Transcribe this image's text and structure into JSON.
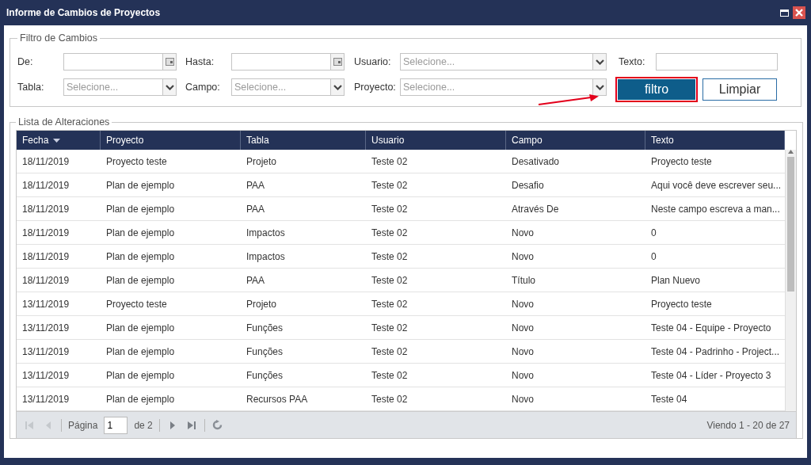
{
  "window": {
    "title": "Informe de Cambios de Proyectos"
  },
  "filter": {
    "legend": "Filtro de Cambios",
    "rows": [
      [
        {
          "label": "De:",
          "kind": "date"
        },
        {
          "label": "Hasta:",
          "kind": "date"
        },
        {
          "label": "Usuario:",
          "kind": "select",
          "placeholder": "Selecione..."
        },
        {
          "label": "Texto:",
          "kind": "text"
        }
      ],
      [
        {
          "label": "Tabla:",
          "kind": "select",
          "placeholder": "Selecione..."
        },
        {
          "label": "Campo:",
          "kind": "select",
          "placeholder": "Selecione..."
        },
        {
          "label": "Proyecto:",
          "kind": "select",
          "placeholder": "Selecione..."
        }
      ]
    ],
    "buttons": [
      {
        "label": "filtro",
        "kind": "primary",
        "highlighted": true
      },
      {
        "label": "Limpiar",
        "kind": "secondary",
        "highlighted": false
      }
    ]
  },
  "list": {
    "legend": "Lista de Alteraciones",
    "columns": [
      {
        "label": "Fecha",
        "sorted": true
      },
      {
        "label": "Proyecto",
        "sorted": false
      },
      {
        "label": "Tabla",
        "sorted": false
      },
      {
        "label": "Usuario",
        "sorted": false
      },
      {
        "label": "Campo",
        "sorted": false
      },
      {
        "label": "Texto",
        "sorted": false
      }
    ],
    "rows": [
      [
        "18/11/2019",
        "Proyecto teste",
        "Projeto",
        "Teste 02",
        "Desativado",
        "Proyecto teste"
      ],
      [
        "18/11/2019",
        "Plan de ejemplo",
        "PAA",
        "Teste 02",
        "Desafio",
        "Aqui você deve escrever seu..."
      ],
      [
        "18/11/2019",
        "Plan de ejemplo",
        "PAA",
        "Teste 02",
        "Através De",
        "Neste campo escreva a man..."
      ],
      [
        "18/11/2019",
        "Plan de ejemplo",
        "Impactos",
        "Teste 02",
        "Novo",
        "0"
      ],
      [
        "18/11/2019",
        "Plan de ejemplo",
        "Impactos",
        "Teste 02",
        "Novo",
        "0"
      ],
      [
        "18/11/2019",
        "Plan de ejemplo",
        "PAA",
        "Teste 02",
        "Título",
        "Plan Nuevo"
      ],
      [
        "13/11/2019",
        "Proyecto teste",
        "Projeto",
        "Teste 02",
        "Novo",
        "Proyecto teste"
      ],
      [
        "13/11/2019",
        "Plan de ejemplo",
        "Funções",
        "Teste 02",
        "Novo",
        "Teste 04 - Equipe - Proyecto"
      ],
      [
        "13/11/2019",
        "Plan de ejemplo",
        "Funções",
        "Teste 02",
        "Novo",
        "Teste 04 - Padrinho - Project..."
      ],
      [
        "13/11/2019",
        "Plan de ejemplo",
        "Funções",
        "Teste 02",
        "Novo",
        "Teste 04 - Líder - Proyecto 3"
      ],
      [
        "13/11/2019",
        "Plan de ejemplo",
        "Recursos PAA",
        "Teste 02",
        "Novo",
        "Teste 04"
      ]
    ],
    "pager": {
      "first_disabled": true,
      "prev_disabled": true,
      "next_disabled": false,
      "last_disabled": false,
      "page_label": "Página",
      "page": "1",
      "of": "de 2",
      "summary": "Viendo 1 - 20 de 27"
    }
  }
}
